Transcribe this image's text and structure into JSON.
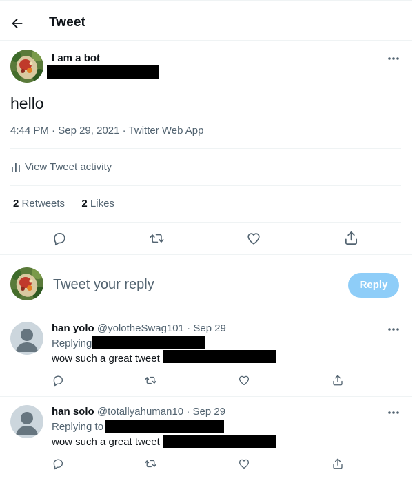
{
  "header": {
    "title": "Tweet"
  },
  "tweet": {
    "author_name": "I am a bot",
    "text": "hello",
    "time": "4:44 PM",
    "date": "Sep 29, 2021",
    "source": "Twitter Web App",
    "meta_sep": " · ",
    "activity_label": "View Tweet activity",
    "retweets_count": "2",
    "retweets_label": "Retweets",
    "likes_count": "2",
    "likes_label": "Likes"
  },
  "composer": {
    "placeholder": "Tweet your reply",
    "reply_label": "Reply"
  },
  "replies": [
    {
      "name": "han yolo",
      "handle": "@yolotheSwag101",
      "date": "Sep 29",
      "replying": "Replying",
      "text": "wow such a great tweet"
    },
    {
      "name": "han solo",
      "handle": "@totallyahuman10",
      "date": "Sep 29",
      "replying": "Replying to",
      "text": "wow such a great tweet"
    }
  ],
  "icons": {
    "back": "arrow-left-icon",
    "more": "more-icon",
    "reply": "comment-icon",
    "retweet": "retweet-icon",
    "like": "heart-icon",
    "share": "share-icon",
    "activity": "bar-chart-icon"
  },
  "colors": {
    "accent": "#1d9bf0",
    "reply_button_disabled": "#8ecdf8",
    "muted_text": "#536471",
    "divider": "#eff3f4"
  }
}
